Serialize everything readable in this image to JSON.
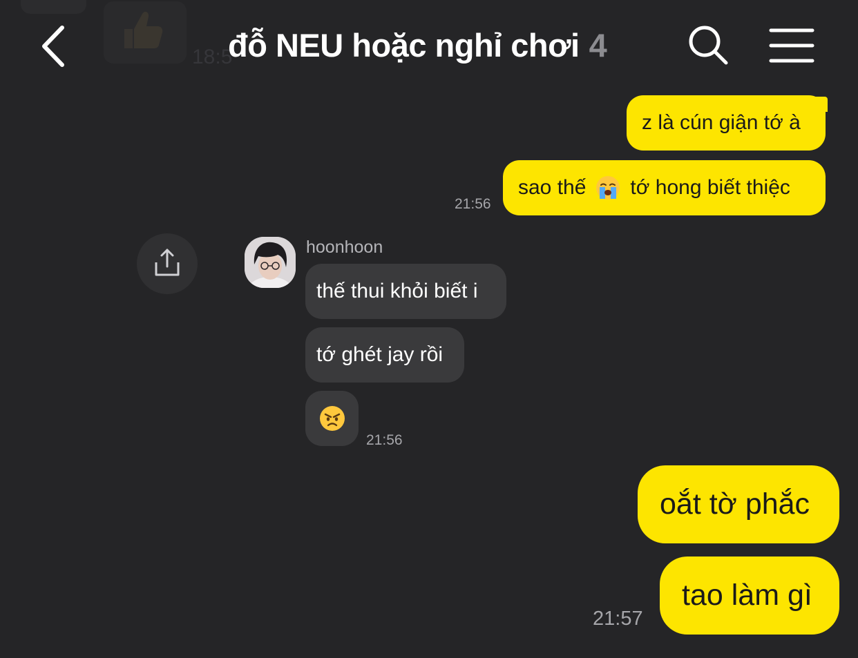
{
  "header": {
    "title": "đỗ NEU hoặc nghỉ chơi",
    "member_count": "4",
    "ghost_time": "18:5"
  },
  "colors": {
    "background": "#252527",
    "my_bubble": "#fde500",
    "their_bubble": "#3a3a3c",
    "timestamp": "#a6a6aa",
    "member_count": "#8c8c90"
  },
  "messages": {
    "m1": {
      "text": "z là cún giận tớ à"
    },
    "m2": {
      "text_before": "sao thế",
      "emoji": "loudly-crying-face",
      "text_after": "tớ hong biết thiệc",
      "time": "21:56"
    },
    "sender": {
      "name": "hoonhoon"
    },
    "m3": {
      "text": "thế thui khỏi biết i"
    },
    "m4": {
      "text": "tớ ghét jay rồi"
    },
    "m5": {
      "emoji": "angry-face",
      "time": "21:56"
    },
    "m6": {
      "text": "oắt tờ phắc"
    },
    "m7": {
      "text": "tao làm gì",
      "time": "21:57"
    }
  }
}
